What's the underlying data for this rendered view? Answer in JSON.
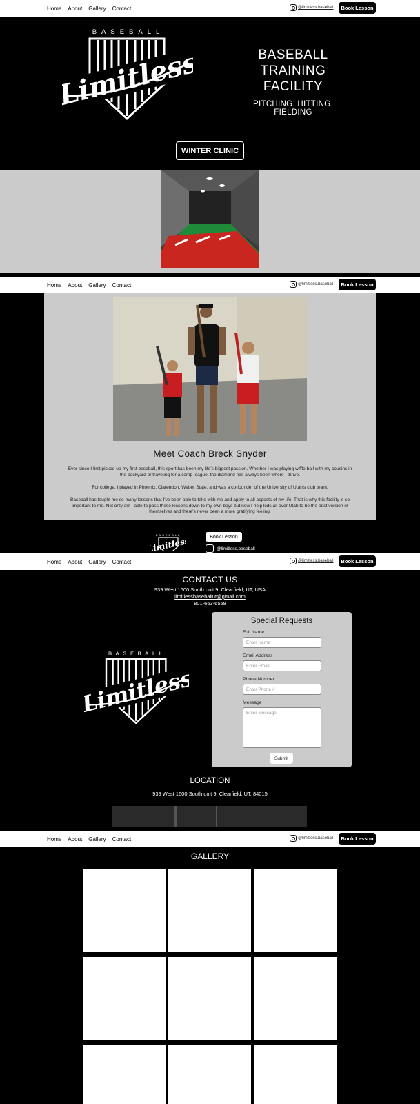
{
  "nav": {
    "links": [
      "Home",
      "About",
      "Gallery",
      "Contact"
    ],
    "instagram": "@limitless.baseball",
    "book_label": "Book Lesson"
  },
  "logo": {
    "top_word": "BASEBALL",
    "script_word": "Limitless"
  },
  "hero": {
    "title_lines": [
      "BASEBALL",
      "TRAINING",
      "FACILITY"
    ],
    "subtitle": "PITCHING. HITTING. FIELDING",
    "cta": "WINTER CLINIC"
  },
  "about": {
    "title": "Meet Coach Breck Snyder",
    "paragraphs": [
      "Ever since I first picked up my first baseball, this sport has been my life's biggest passion. Whether I was playing wiffle ball with my cousins in the backyard or traveling for a comp league, the diamond has always been where I thrive.",
      "For college, I played in Phoenix, Clarendon, Weber State, and was a co-founder of the University of Utah's club team.",
      "Baseball has taught me so many lessons that I've been able to take with me and apply to all aspects of my life. That is why this facility is so important to me. Not only am I able to pass these lessons down to my own boys but now I help kids all over Utah to be the best version of themselves and there's never been a more gratifying feeling."
    ],
    "footer_book": "Book Lesson",
    "footer_ig": "@limitless.baseball"
  },
  "contact": {
    "title": "CONTACT US",
    "address": "939 West 1600 South unit 9, Clearfield, UT, USA",
    "email": "limitlessbaseballut@gmail.com",
    "phone": "801-663-6558",
    "form": {
      "title": "Special Requests",
      "fields": [
        {
          "label": "Full Name",
          "placeholder": "Enter Name"
        },
        {
          "label": "Email Address",
          "placeholder": "Enter Email"
        },
        {
          "label": "Phone Number",
          "placeholder": "Enter Phone #"
        },
        {
          "label": "Message",
          "placeholder": "Enter Message"
        }
      ],
      "submit": "Submit"
    },
    "location_title": "LOCATION",
    "location_address": "939 West 1600 South unit 9, Clearfield, UT, 84015"
  },
  "gallery": {
    "title": "GALLERY"
  },
  "colors": {
    "background": "#000000",
    "panel": "#cbcbcb",
    "nav": "#ffffff",
    "turf": "#1f8a3a",
    "mat": "#c8261e"
  }
}
